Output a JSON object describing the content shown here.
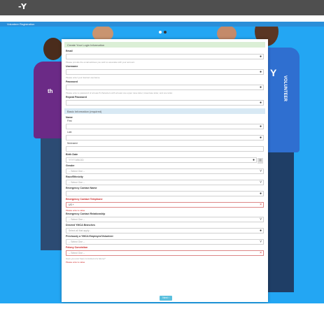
{
  "header": {
    "logo": "-Y",
    "banner_title": "Volunteer Registration"
  },
  "hero": {
    "shirt_text_left": "th",
    "shirt_text_right": "VOLUNTEER",
    "carousel_dots": 2,
    "active_dot": 1
  },
  "login_section": {
    "title": "Create Your Login Information",
    "email": {
      "label": "Email",
      "hint": "Please provide the email address you wish to associate with your account."
    },
    "username": {
      "label": "Username",
      "hint": "Please enter your desired username."
    },
    "password": {
      "label": "Password",
      "hint": "Please enter a password of at least 8 characters with at least one upper case letter, lowercase letter, and one letter."
    },
    "repeat_password": {
      "label": "Repeat Password"
    }
  },
  "basic_section": {
    "title": "Basic Information (required)",
    "name": {
      "label": "Name",
      "first": "First",
      "last": "Last",
      "nickname": "Nickname"
    },
    "birth_date": {
      "label": "Birth Date",
      "placeholder": "YYYY-MM-DD"
    },
    "gender": {
      "label": "Gender",
      "value": "-- Select One --"
    },
    "race": {
      "label": "Race/Ethnicity",
      "value": "-- Select One --"
    },
    "emergency_name": {
      "label": "Emergency Contact Name"
    },
    "emergency_phone": {
      "label": "Emergency Contact Telephone",
      "value": "US +",
      "error": "Please enter a value"
    },
    "emergency_rel": {
      "label": "Emergency Contact Relationship",
      "value": "-- Select One --"
    },
    "branches": {
      "label": "Desired YMCA Branches",
      "value": "Select all that apply..."
    },
    "prev_employee": {
      "label": "Previously a YMCA Employee/Volunteer",
      "value": "-- Select One --"
    },
    "felony": {
      "label": "Felony Conviction",
      "value": "-- Select One --",
      "hint": "Have you ever been convicted of a felony?",
      "error": "Please enter a value"
    }
  },
  "next_button": "Next ›"
}
